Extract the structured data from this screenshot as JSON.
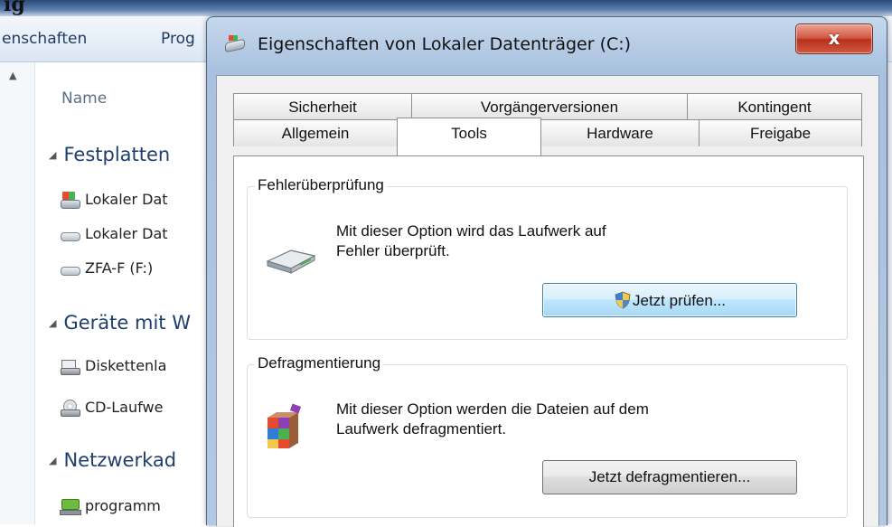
{
  "top_heading": "ig",
  "explorer": {
    "toolbar": {
      "item_properties": "enschaften",
      "item_programs": "Prog"
    },
    "column_name": "Name",
    "groups": {
      "hard_disks": "Festplatten",
      "removable": "Geräte mit W",
      "network": "Netzwerkad"
    },
    "items": {
      "drive_c": "Lokaler Dat",
      "drive_d": "Lokaler Dat",
      "drive_f": "ZFA-F (F:)",
      "floppy": "Diskettenla",
      "cd": "CD-Laufwe",
      "net": "programm"
    }
  },
  "dialog": {
    "title": "Eigenschaften von Lokaler Datenträger (C:)",
    "close_glyph": "x",
    "tabs_row_back": [
      "Sicherheit",
      "Vorgängerversionen",
      "Kontingent"
    ],
    "tabs_row_front": [
      "Allgemein",
      "Tools",
      "Hardware",
      "Freigabe"
    ],
    "active_tab": "Tools",
    "error_checking": {
      "title": "Fehlerüberprüfung",
      "description_line1": "Mit dieser Option wird das Laufwerk auf",
      "description_line2": "Fehler überprüft.",
      "button": "Jetzt prüfen..."
    },
    "defrag": {
      "title": "Defragmentierung",
      "description_line1": "Mit dieser Option werden die Dateien auf dem",
      "description_line2": "Laufwerk defragmentiert.",
      "button": "Jetzt defragmentieren..."
    }
  }
}
